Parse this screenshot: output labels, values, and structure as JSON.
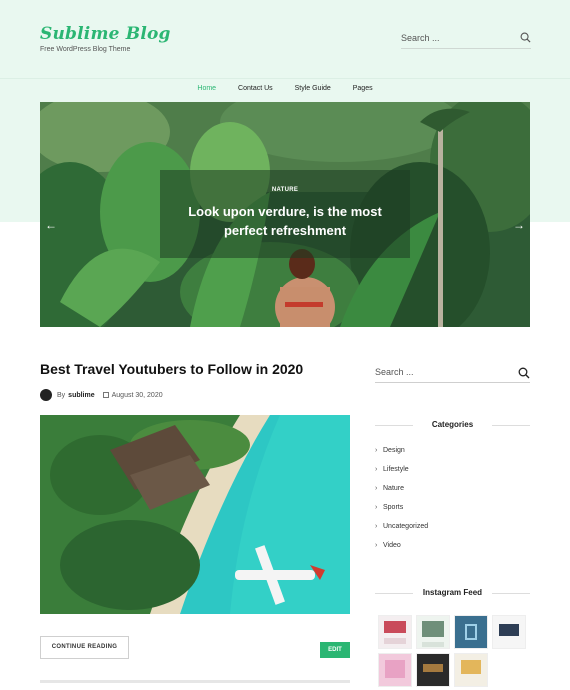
{
  "site": {
    "title": "Sublime Blog",
    "tagline": "Free WordPress Blog Theme"
  },
  "header_search": {
    "placeholder": "Search ..."
  },
  "nav": {
    "items": [
      "Home",
      "Contact Us",
      "Style Guide",
      "Pages"
    ],
    "active": "Home"
  },
  "slider": {
    "category": "NATURE",
    "title": "Look upon verdure, is the most perfect refreshment",
    "prev_icon": "arrow-left-icon",
    "next_icon": "arrow-right-icon"
  },
  "post": {
    "title": "Best Travel Youtubers to Follow in 2020",
    "by": "By",
    "author": "sublime",
    "date": "August 30, 2020",
    "continue_label": "CONTINUE READING",
    "edit_label": "EDIT"
  },
  "sidebar": {
    "search_placeholder": "Search ...",
    "categories_title": "Categories",
    "categories": [
      "Design",
      "Lifestyle",
      "Nature",
      "Sports",
      "Uncategorized",
      "Video"
    ],
    "instagram_title": "Instagram Feed"
  },
  "colors": {
    "accent": "#2bb673",
    "header_bg": "#e9f8f0"
  }
}
